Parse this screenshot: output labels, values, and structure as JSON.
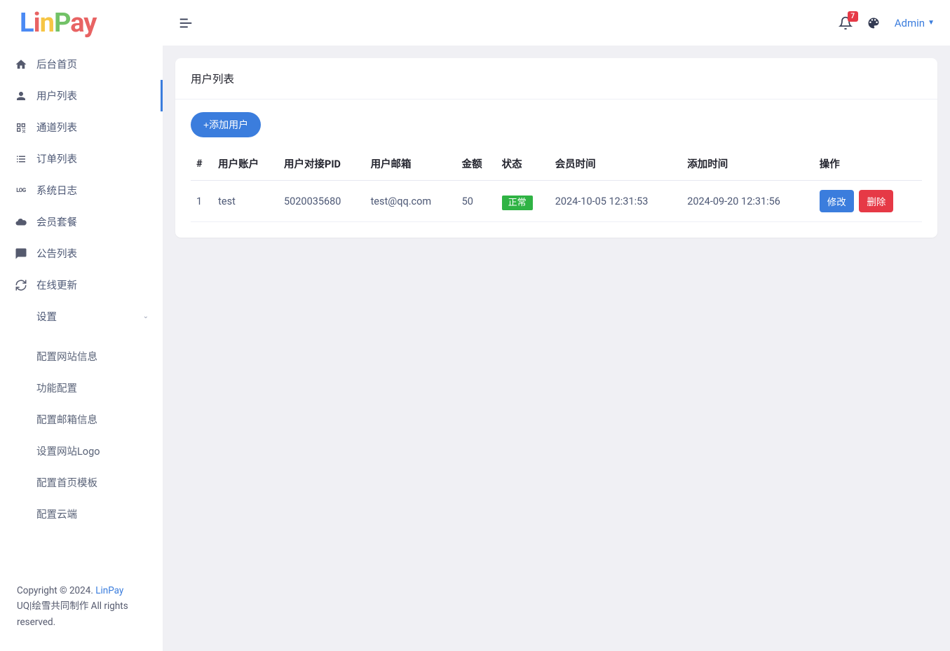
{
  "logo": {
    "text": "LinPay"
  },
  "notificationBadge": "7",
  "userMenuLabel": "Admin",
  "sidebar": {
    "items": [
      {
        "label": "后台首页",
        "icon": "home"
      },
      {
        "label": "用户列表",
        "icon": "user",
        "active": true
      },
      {
        "label": "通道列表",
        "icon": "qr"
      },
      {
        "label": "订单列表",
        "icon": "list"
      },
      {
        "label": "系统日志",
        "icon": "log"
      },
      {
        "label": "会员套餐",
        "icon": "cloud"
      },
      {
        "label": "公告列表",
        "icon": "chat"
      },
      {
        "label": "在线更新",
        "icon": "refresh"
      },
      {
        "label": "设置",
        "icon": "gear",
        "expandable": true
      }
    ],
    "settingsChildren": [
      {
        "label": "配置网站信息"
      },
      {
        "label": "功能配置"
      },
      {
        "label": "配置邮箱信息"
      },
      {
        "label": "设置网站Logo"
      },
      {
        "label": "配置首页模板"
      },
      {
        "label": "配置云端"
      }
    ]
  },
  "footer": {
    "prefix": "Copyright © 2024. ",
    "link": "LinPay",
    "suffix": "UQ|绘雪共同制作 All rights reserved."
  },
  "page": {
    "title": "用户列表",
    "addButton": "+添加用户",
    "columns": [
      "#",
      "用户账户",
      "用户对接PID",
      "用户邮箱",
      "金额",
      "状态",
      "会员时间",
      "添加时间",
      "操作"
    ],
    "rows": [
      {
        "idx": "1",
        "account": "test",
        "pid": "5020035680",
        "email": "test@qq.com",
        "amount": "50",
        "status": "正常",
        "vipTime": "2024-10-05 12:31:53",
        "addTime": "2024-09-20 12:31:56"
      }
    ],
    "editLabel": "修改",
    "deleteLabel": "删除"
  }
}
